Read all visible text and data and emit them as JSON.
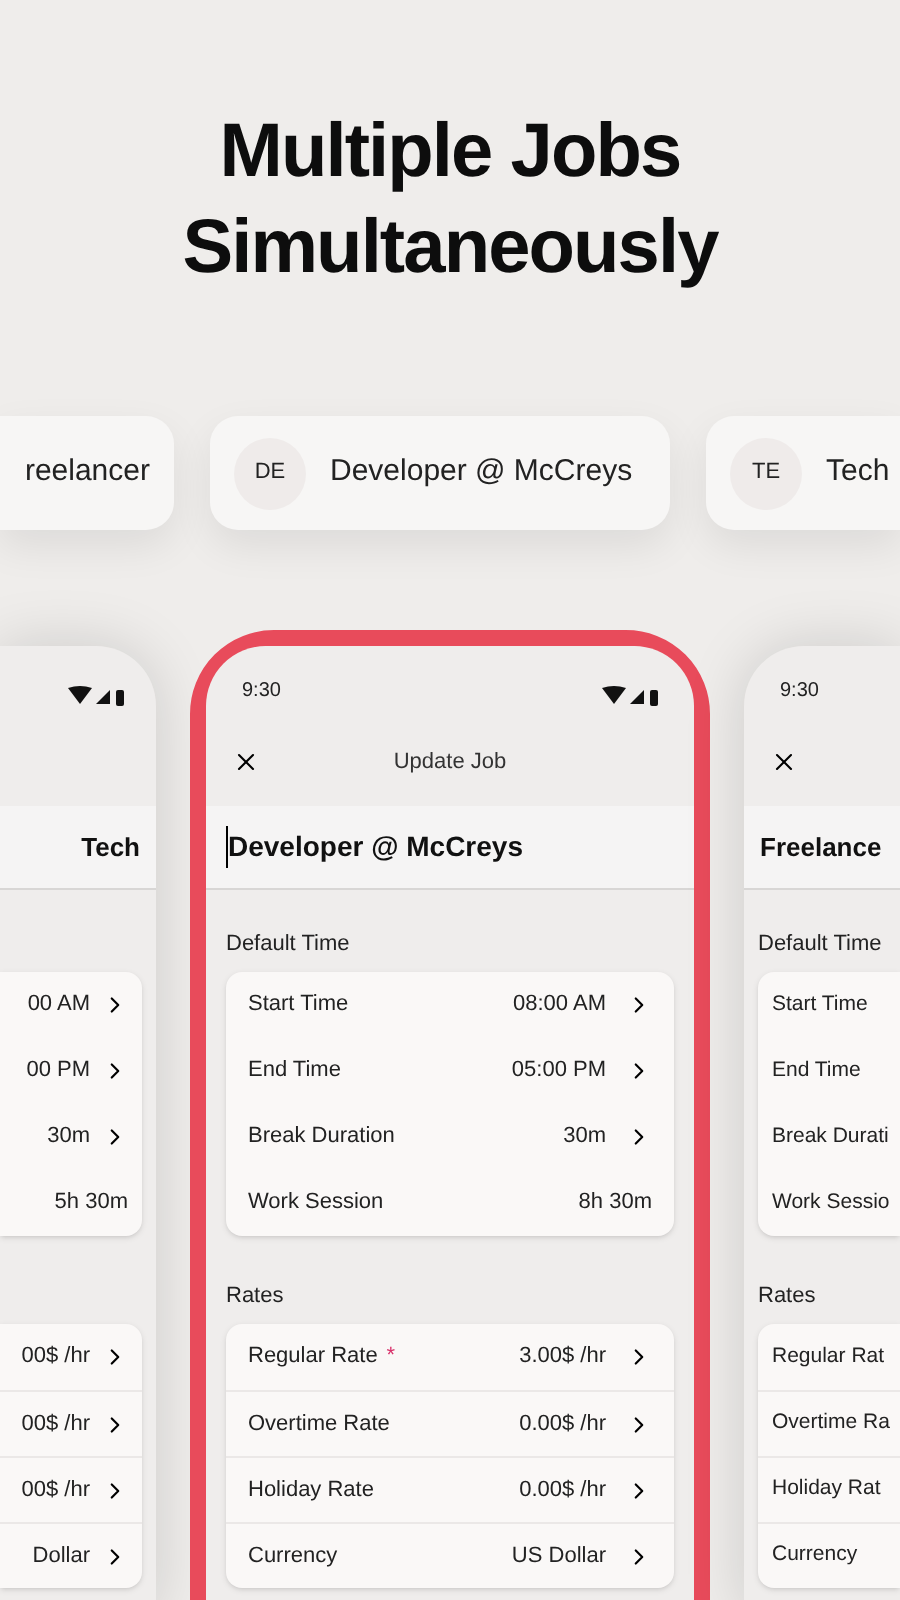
{
  "headline": [
    "Multiple Jobs",
    "Simultaneously"
  ],
  "job_chips": [
    {
      "name": "reelancer"
    },
    {
      "initials": "DE",
      "name": "Developer @ McCreys"
    },
    {
      "initials": "TE",
      "name": "Tech"
    }
  ],
  "phones": [
    {
      "job_title": "Tech",
      "status_icons": true,
      "sections": [
        {
          "rows": [
            {
              "value": "00 AM",
              "chevron": true
            },
            {
              "value": "00 PM",
              "chevron": true
            },
            {
              "value": "30m",
              "chevron": true
            },
            {
              "value": "5h 30m",
              "chevron": false
            }
          ]
        },
        {
          "rows": [
            {
              "value": "00$ /hr",
              "chevron": true
            },
            {
              "value": "00$ /hr",
              "chevron": true
            },
            {
              "value": "00$ /hr",
              "chevron": true
            },
            {
              "value": "Dollar",
              "chevron": true
            }
          ]
        }
      ]
    },
    {
      "time": "9:30",
      "status_icons": true,
      "close": true,
      "header": "Update Job",
      "job_title": "Developer @ McCreys",
      "highlighted": true,
      "sections": [
        {
          "title": "Default Time",
          "rows": [
            {
              "label": "Start Time",
              "value": "08:00 AM",
              "chevron": true
            },
            {
              "label": "End Time",
              "value": "05:00 PM",
              "chevron": true
            },
            {
              "label": "Break Duration",
              "value": "30m",
              "chevron": true
            },
            {
              "label": "Work Session",
              "value": "8h 30m",
              "chevron": false
            }
          ]
        },
        {
          "title": "Rates",
          "rows": [
            {
              "label": "Regular Rate",
              "required_mark": "*",
              "value": "3.00$ /hr",
              "chevron": true
            },
            {
              "label": "Overtime Rate",
              "value": "0.00$ /hr",
              "chevron": true
            },
            {
              "label": "Holiday Rate",
              "value": "0.00$ /hr",
              "chevron": true
            },
            {
              "label": "Currency",
              "value": "US Dollar",
              "chevron": true
            }
          ]
        }
      ]
    },
    {
      "time": "9:30",
      "close": true,
      "job_title": "Freelance",
      "sections": [
        {
          "title": "Default Time",
          "rows": [
            {
              "label": "Start Time"
            },
            {
              "label": "End Time"
            },
            {
              "label": "Break Durati"
            },
            {
              "label": "Work Sessio"
            }
          ]
        },
        {
          "title": "Rates",
          "rows": [
            {
              "label": "Regular Rat"
            },
            {
              "label": "Overtime Ra"
            },
            {
              "label": "Holiday Rat"
            },
            {
              "label": "Currency"
            }
          ]
        }
      ]
    }
  ]
}
